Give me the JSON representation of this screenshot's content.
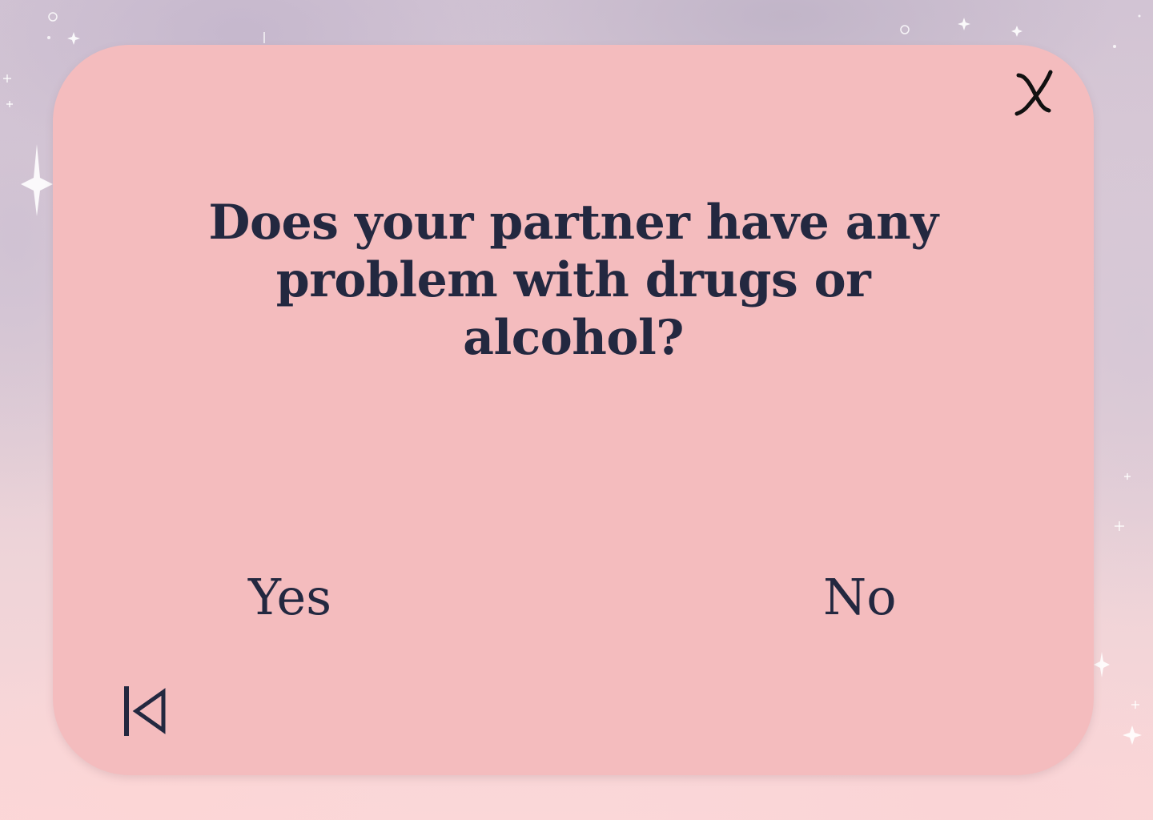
{
  "card": {
    "question": "Does your partner have any problem with drugs or alcohol?",
    "answers": {
      "yes_label": "Yes",
      "no_label": "No"
    }
  },
  "icons": {
    "close": "close-icon",
    "back": "skip-back-icon"
  },
  "colors": {
    "card_background": "#f4bcbe",
    "text": "#232840"
  }
}
